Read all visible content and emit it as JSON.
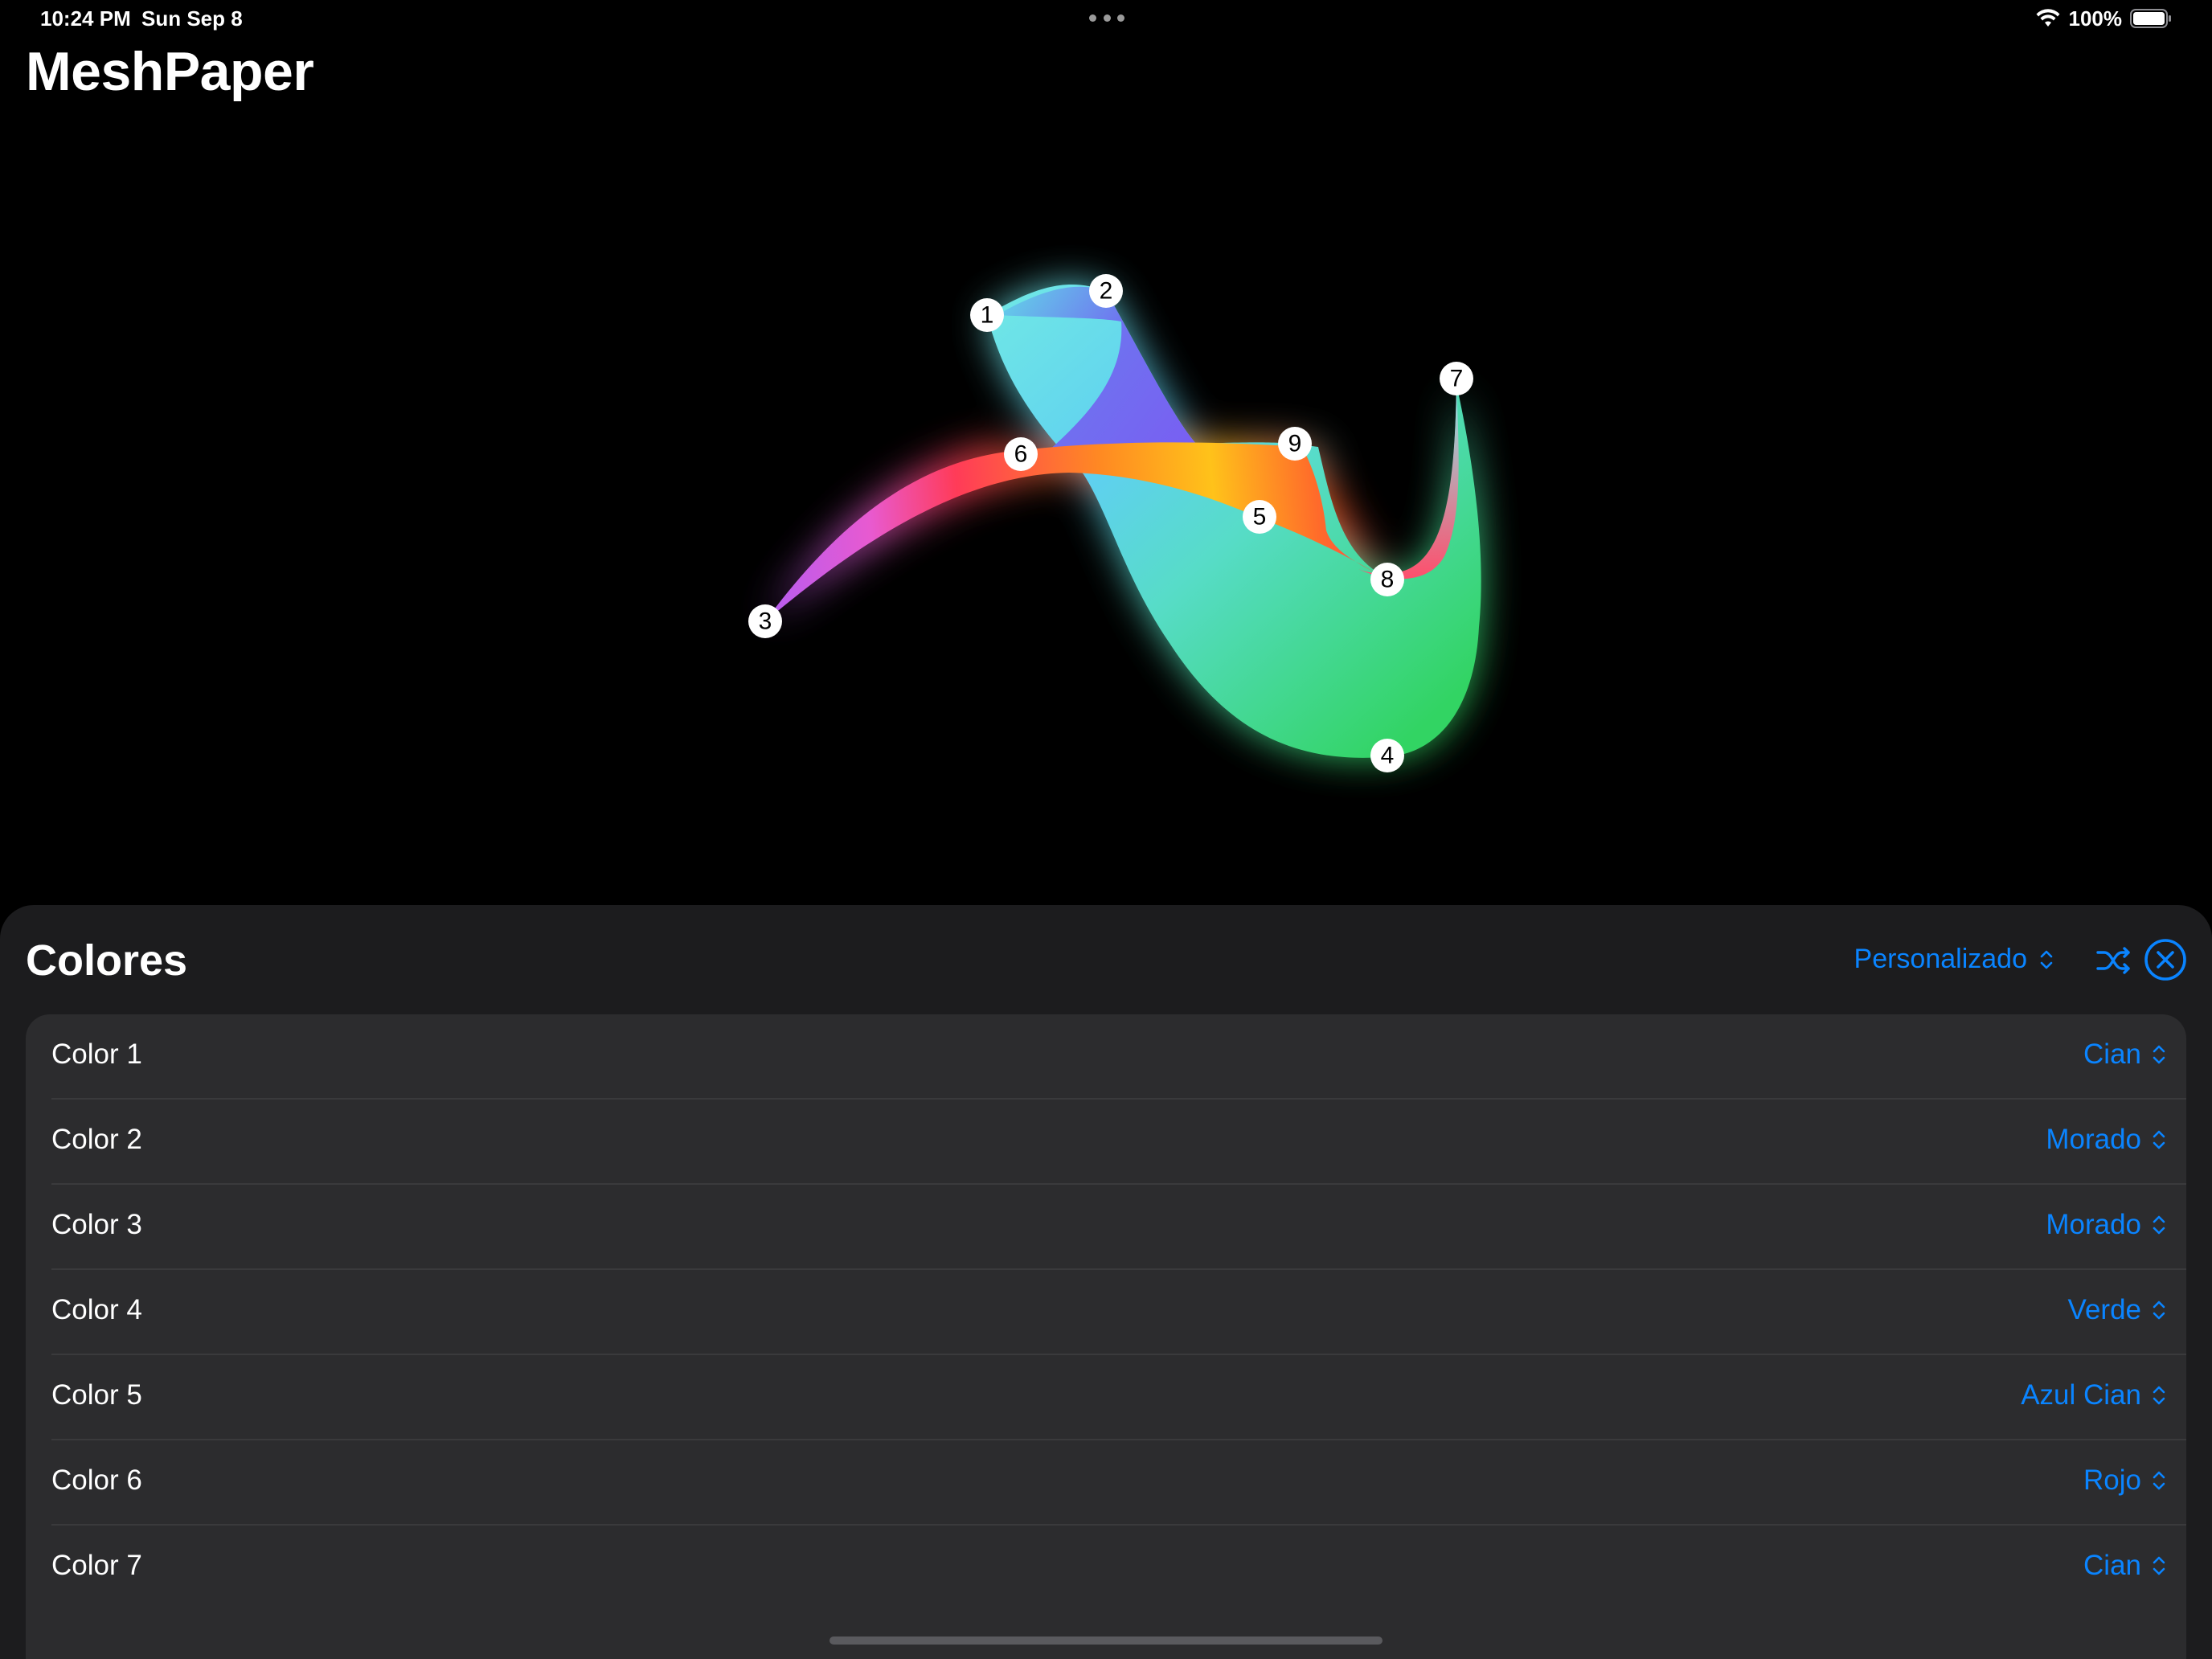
{
  "status_bar": {
    "time": "10:24 PM",
    "date": "Sun Sep 8",
    "battery": "100%",
    "icons": [
      "wifi-icon",
      "battery-icon",
      "multitask-dots-icon"
    ]
  },
  "app": {
    "title": "MeshPaper"
  },
  "canvas": {
    "control_points": [
      "1",
      "2",
      "3",
      "4",
      "5",
      "6",
      "7",
      "8",
      "9"
    ],
    "colors": {
      "cyan": "#5fe0e0",
      "purple": "#7b5cf0",
      "orange": "#ff9f0a",
      "yellow": "#ffd60a",
      "red": "#ff375f",
      "green": "#30d158",
      "sky": "#64d2ff"
    }
  },
  "panel": {
    "title": "Colores",
    "preset": "Personalizado",
    "icons": [
      "chevron-updown-icon",
      "shuffle-icon",
      "close-circle-icon"
    ],
    "accent": "#0a84ff",
    "rows": [
      {
        "label": "Color 1",
        "value": "Cian"
      },
      {
        "label": "Color 2",
        "value": "Morado"
      },
      {
        "label": "Color 3",
        "value": "Morado"
      },
      {
        "label": "Color 4",
        "value": "Verde"
      },
      {
        "label": "Color 5",
        "value": "Azul Cian"
      },
      {
        "label": "Color 6",
        "value": "Rojo"
      },
      {
        "label": "Color 7",
        "value": "Cian"
      }
    ]
  }
}
